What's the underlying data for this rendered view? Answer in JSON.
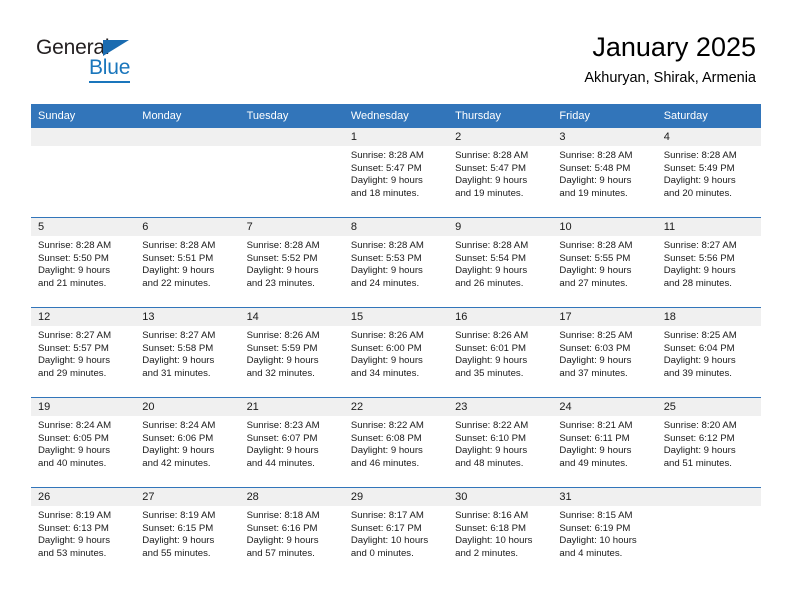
{
  "logo": {
    "word_one": "General",
    "word_two": "Blue",
    "triangle_icon": "triangle-icon",
    "brand_color": "#1a76bc"
  },
  "header": {
    "title": "January 2025",
    "subtitle": "Akhuryan, Shirak, Armenia",
    "header_bg_color": "#3275ba",
    "date_band_color": "#f0f0f0"
  },
  "weekdays": [
    "Sunday",
    "Monday",
    "Tuesday",
    "Wednesday",
    "Thursday",
    "Friday",
    "Saturday"
  ],
  "weeks": [
    [
      {
        "empty": true
      },
      {
        "empty": true
      },
      {
        "empty": true
      },
      {
        "day": "1",
        "sunrise": "Sunrise: 8:28 AM",
        "sunset": "Sunset: 5:47 PM",
        "daylight_1": "Daylight: 9 hours",
        "daylight_2": "and 18 minutes."
      },
      {
        "day": "2",
        "sunrise": "Sunrise: 8:28 AM",
        "sunset": "Sunset: 5:47 PM",
        "daylight_1": "Daylight: 9 hours",
        "daylight_2": "and 19 minutes."
      },
      {
        "day": "3",
        "sunrise": "Sunrise: 8:28 AM",
        "sunset": "Sunset: 5:48 PM",
        "daylight_1": "Daylight: 9 hours",
        "daylight_2": "and 19 minutes."
      },
      {
        "day": "4",
        "sunrise": "Sunrise: 8:28 AM",
        "sunset": "Sunset: 5:49 PM",
        "daylight_1": "Daylight: 9 hours",
        "daylight_2": "and 20 minutes."
      }
    ],
    [
      {
        "day": "5",
        "sunrise": "Sunrise: 8:28 AM",
        "sunset": "Sunset: 5:50 PM",
        "daylight_1": "Daylight: 9 hours",
        "daylight_2": "and 21 minutes."
      },
      {
        "day": "6",
        "sunrise": "Sunrise: 8:28 AM",
        "sunset": "Sunset: 5:51 PM",
        "daylight_1": "Daylight: 9 hours",
        "daylight_2": "and 22 minutes."
      },
      {
        "day": "7",
        "sunrise": "Sunrise: 8:28 AM",
        "sunset": "Sunset: 5:52 PM",
        "daylight_1": "Daylight: 9 hours",
        "daylight_2": "and 23 minutes."
      },
      {
        "day": "8",
        "sunrise": "Sunrise: 8:28 AM",
        "sunset": "Sunset: 5:53 PM",
        "daylight_1": "Daylight: 9 hours",
        "daylight_2": "and 24 minutes."
      },
      {
        "day": "9",
        "sunrise": "Sunrise: 8:28 AM",
        "sunset": "Sunset: 5:54 PM",
        "daylight_1": "Daylight: 9 hours",
        "daylight_2": "and 26 minutes."
      },
      {
        "day": "10",
        "sunrise": "Sunrise: 8:28 AM",
        "sunset": "Sunset: 5:55 PM",
        "daylight_1": "Daylight: 9 hours",
        "daylight_2": "and 27 minutes."
      },
      {
        "day": "11",
        "sunrise": "Sunrise: 8:27 AM",
        "sunset": "Sunset: 5:56 PM",
        "daylight_1": "Daylight: 9 hours",
        "daylight_2": "and 28 minutes."
      }
    ],
    [
      {
        "day": "12",
        "sunrise": "Sunrise: 8:27 AM",
        "sunset": "Sunset: 5:57 PM",
        "daylight_1": "Daylight: 9 hours",
        "daylight_2": "and 29 minutes."
      },
      {
        "day": "13",
        "sunrise": "Sunrise: 8:27 AM",
        "sunset": "Sunset: 5:58 PM",
        "daylight_1": "Daylight: 9 hours",
        "daylight_2": "and 31 minutes."
      },
      {
        "day": "14",
        "sunrise": "Sunrise: 8:26 AM",
        "sunset": "Sunset: 5:59 PM",
        "daylight_1": "Daylight: 9 hours",
        "daylight_2": "and 32 minutes."
      },
      {
        "day": "15",
        "sunrise": "Sunrise: 8:26 AM",
        "sunset": "Sunset: 6:00 PM",
        "daylight_1": "Daylight: 9 hours",
        "daylight_2": "and 34 minutes."
      },
      {
        "day": "16",
        "sunrise": "Sunrise: 8:26 AM",
        "sunset": "Sunset: 6:01 PM",
        "daylight_1": "Daylight: 9 hours",
        "daylight_2": "and 35 minutes."
      },
      {
        "day": "17",
        "sunrise": "Sunrise: 8:25 AM",
        "sunset": "Sunset: 6:03 PM",
        "daylight_1": "Daylight: 9 hours",
        "daylight_2": "and 37 minutes."
      },
      {
        "day": "18",
        "sunrise": "Sunrise: 8:25 AM",
        "sunset": "Sunset: 6:04 PM",
        "daylight_1": "Daylight: 9 hours",
        "daylight_2": "and 39 minutes."
      }
    ],
    [
      {
        "day": "19",
        "sunrise": "Sunrise: 8:24 AM",
        "sunset": "Sunset: 6:05 PM",
        "daylight_1": "Daylight: 9 hours",
        "daylight_2": "and 40 minutes."
      },
      {
        "day": "20",
        "sunrise": "Sunrise: 8:24 AM",
        "sunset": "Sunset: 6:06 PM",
        "daylight_1": "Daylight: 9 hours",
        "daylight_2": "and 42 minutes."
      },
      {
        "day": "21",
        "sunrise": "Sunrise: 8:23 AM",
        "sunset": "Sunset: 6:07 PM",
        "daylight_1": "Daylight: 9 hours",
        "daylight_2": "and 44 minutes."
      },
      {
        "day": "22",
        "sunrise": "Sunrise: 8:22 AM",
        "sunset": "Sunset: 6:08 PM",
        "daylight_1": "Daylight: 9 hours",
        "daylight_2": "and 46 minutes."
      },
      {
        "day": "23",
        "sunrise": "Sunrise: 8:22 AM",
        "sunset": "Sunset: 6:10 PM",
        "daylight_1": "Daylight: 9 hours",
        "daylight_2": "and 48 minutes."
      },
      {
        "day": "24",
        "sunrise": "Sunrise: 8:21 AM",
        "sunset": "Sunset: 6:11 PM",
        "daylight_1": "Daylight: 9 hours",
        "daylight_2": "and 49 minutes."
      },
      {
        "day": "25",
        "sunrise": "Sunrise: 8:20 AM",
        "sunset": "Sunset: 6:12 PM",
        "daylight_1": "Daylight: 9 hours",
        "daylight_2": "and 51 minutes."
      }
    ],
    [
      {
        "day": "26",
        "sunrise": "Sunrise: 8:19 AM",
        "sunset": "Sunset: 6:13 PM",
        "daylight_1": "Daylight: 9 hours",
        "daylight_2": "and 53 minutes."
      },
      {
        "day": "27",
        "sunrise": "Sunrise: 8:19 AM",
        "sunset": "Sunset: 6:15 PM",
        "daylight_1": "Daylight: 9 hours",
        "daylight_2": "and 55 minutes."
      },
      {
        "day": "28",
        "sunrise": "Sunrise: 8:18 AM",
        "sunset": "Sunset: 6:16 PM",
        "daylight_1": "Daylight: 9 hours",
        "daylight_2": "and 57 minutes."
      },
      {
        "day": "29",
        "sunrise": "Sunrise: 8:17 AM",
        "sunset": "Sunset: 6:17 PM",
        "daylight_1": "Daylight: 10 hours",
        "daylight_2": "and 0 minutes."
      },
      {
        "day": "30",
        "sunrise": "Sunrise: 8:16 AM",
        "sunset": "Sunset: 6:18 PM",
        "daylight_1": "Daylight: 10 hours",
        "daylight_2": "and 2 minutes."
      },
      {
        "day": "31",
        "sunrise": "Sunrise: 8:15 AM",
        "sunset": "Sunset: 6:19 PM",
        "daylight_1": "Daylight: 10 hours",
        "daylight_2": "and 4 minutes."
      },
      {
        "empty": true
      }
    ]
  ]
}
